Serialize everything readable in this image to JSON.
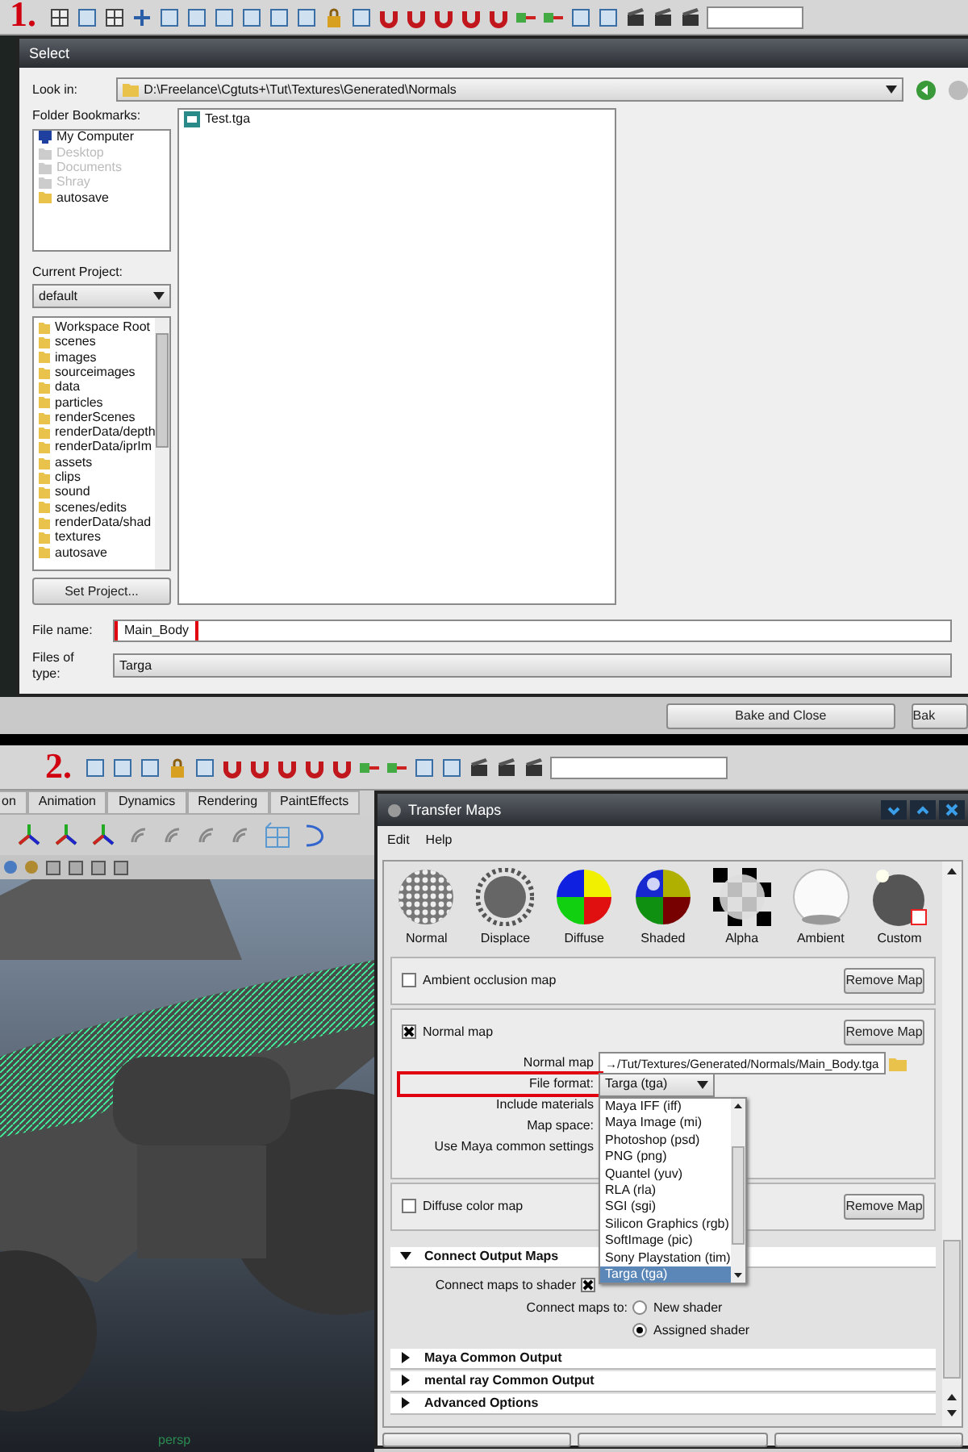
{
  "step_labels": [
    "1.",
    "2."
  ],
  "panel1": {
    "dialog_title": "Select",
    "look_in_label": "Look in:",
    "look_in_path": "D:\\Freelance\\Cgtuts+\\Tut\\Textures\\Generated\\Normals",
    "bookmarks_label": "Folder Bookmarks:",
    "bookmarks": [
      {
        "label": "My Computer",
        "disabled": false
      },
      {
        "label": "Desktop",
        "disabled": true
      },
      {
        "label": "Documents",
        "disabled": true
      },
      {
        "label": "Shray",
        "disabled": true
      },
      {
        "label": "autosave",
        "disabled": false
      }
    ],
    "current_project_label": "Current Project:",
    "current_project": "default",
    "folders": [
      "Workspace Root",
      "scenes",
      "images",
      "sourceimages",
      "data",
      "particles",
      "renderScenes",
      "renderData/depth",
      "renderData/iprIm",
      "assets",
      "clips",
      "sound",
      "scenes/edits",
      "renderData/shad",
      "textures",
      "autosave"
    ],
    "set_project_button": "Set Project...",
    "files": [
      "Test.tga"
    ],
    "file_name_label": "File name:",
    "file_name": "Main_Body",
    "file_name_highlighted": true,
    "files_of_type_label": "Files of type:",
    "files_of_type": "Targa",
    "background_buttons": [
      "Bake and Close",
      "Bak"
    ]
  },
  "panel2": {
    "shelf_tabs": [
      "on",
      "Animation",
      "Dynamics",
      "Rendering",
      "PaintEffects"
    ],
    "viewport_label": "persp",
    "window_title": "Transfer Maps",
    "menu": [
      "Edit",
      "Help"
    ],
    "map_types": [
      "Normal",
      "Displace",
      "Diffuse",
      "Shaded",
      "Alpha",
      "Ambient",
      "Custom"
    ],
    "maps": [
      {
        "label": "Ambient occlusion map",
        "checked": false,
        "button": "Remove Map"
      },
      {
        "label": "Normal map",
        "checked": true,
        "button": "Remove Map",
        "fields": [
          {
            "label": "Normal map",
            "value": "→/Tut/Textures/Generated/Normals/Main_Body.tga",
            "kind": "path"
          },
          {
            "label": "File format:",
            "value": "Targa (tga)",
            "kind": "combo",
            "highlighted": true
          },
          {
            "label": "Include materials",
            "kind": "hidden"
          },
          {
            "label": "Map space:",
            "kind": "hidden"
          },
          {
            "label": "Use Maya common settings",
            "kind": "hidden"
          }
        ]
      },
      {
        "label": "Diffuse color map",
        "checked": false,
        "button": "Remove Map"
      }
    ],
    "format_options": [
      {
        "label": "Maya IFF (iff)",
        "selected": false
      },
      {
        "label": "Maya Image (mi)",
        "selected": false
      },
      {
        "label": "Photoshop (psd)",
        "selected": false
      },
      {
        "label": "PNG (png)",
        "selected": false
      },
      {
        "label": "Quantel (yuv)",
        "selected": false
      },
      {
        "label": "RLA (rla)",
        "selected": false
      },
      {
        "label": "SGI (sgi)",
        "selected": false
      },
      {
        "label": "Silicon Graphics (rgb)",
        "selected": false
      },
      {
        "label": "SoftImage (pic)",
        "selected": false
      },
      {
        "label": "Sony Playstation (tim)",
        "selected": false
      },
      {
        "label": "Targa (tga)",
        "selected": true
      }
    ],
    "sections": [
      {
        "title": "Connect Output Maps",
        "expanded": true
      },
      {
        "title": "Maya Common Output",
        "expanded": false
      },
      {
        "title": "mental ray Common Output",
        "expanded": false
      },
      {
        "title": "Advanced Options",
        "expanded": false
      }
    ],
    "connect_label": "Connect maps to shader",
    "connect_checked": true,
    "connect_to_label": "Connect maps to:",
    "connect_options": [
      {
        "label": "New shader",
        "selected": false
      },
      {
        "label": "Assigned shader",
        "selected": true
      }
    ]
  }
}
